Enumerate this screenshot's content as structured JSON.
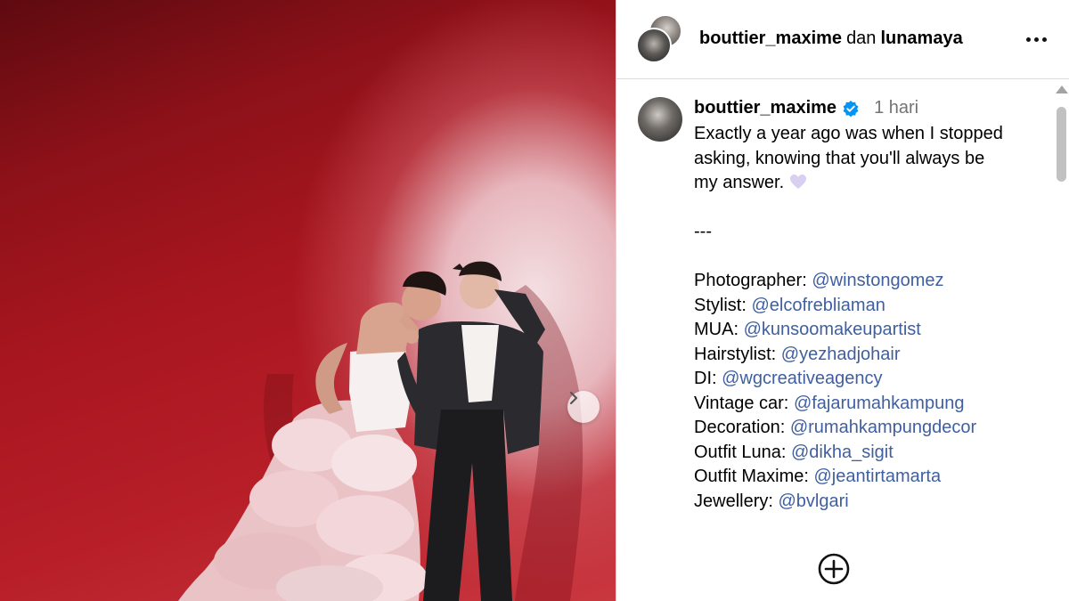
{
  "header": {
    "user_primary": "bouttier_maxime",
    "joiner": "dan",
    "user_secondary": "lunamaya",
    "more_icon": "more-horizontal-icon"
  },
  "post": {
    "author": "bouttier_maxime",
    "verified": true,
    "timestamp": "1 hari",
    "caption_lines": [
      "Exactly a year ago was when I stopped",
      "asking, knowing that you'll always be",
      "my answer."
    ],
    "emoji": "purple-heart",
    "separator": "---",
    "credits": [
      {
        "role": "Photographer:",
        "handle": "@winstongomez"
      },
      {
        "role": "Stylist:",
        "handle": "@elcofrebliaman"
      },
      {
        "role": "MUA:",
        "handle": "@kunsoomakeupartist"
      },
      {
        "role": "Hairstylist:",
        "handle": "@yezhadjohair"
      },
      {
        "role": "DI:",
        "handle": "@wgcreativeagency"
      },
      {
        "role": "Vintage car:",
        "handle": "@fajarumahkampung"
      },
      {
        "role": "Decoration:",
        "handle": "@rumahkampungdecor"
      },
      {
        "role": "Outfit Luna:",
        "handle": "@dikha_sigit"
      },
      {
        "role": "Outfit Maxime:",
        "handle": "@jeantirtamarta"
      },
      {
        "role": "Jewellery:",
        "handle": "@bvlgari"
      }
    ]
  },
  "colors": {
    "link": "#3f5fa0",
    "verified_badge": "#0095f6",
    "timestamp": "#737373",
    "photo_background": "#b71e28"
  },
  "icons": {
    "next_photo": "chevron-right-icon",
    "add_comment": "plus-circle-icon",
    "verified": "verified-badge-icon"
  }
}
